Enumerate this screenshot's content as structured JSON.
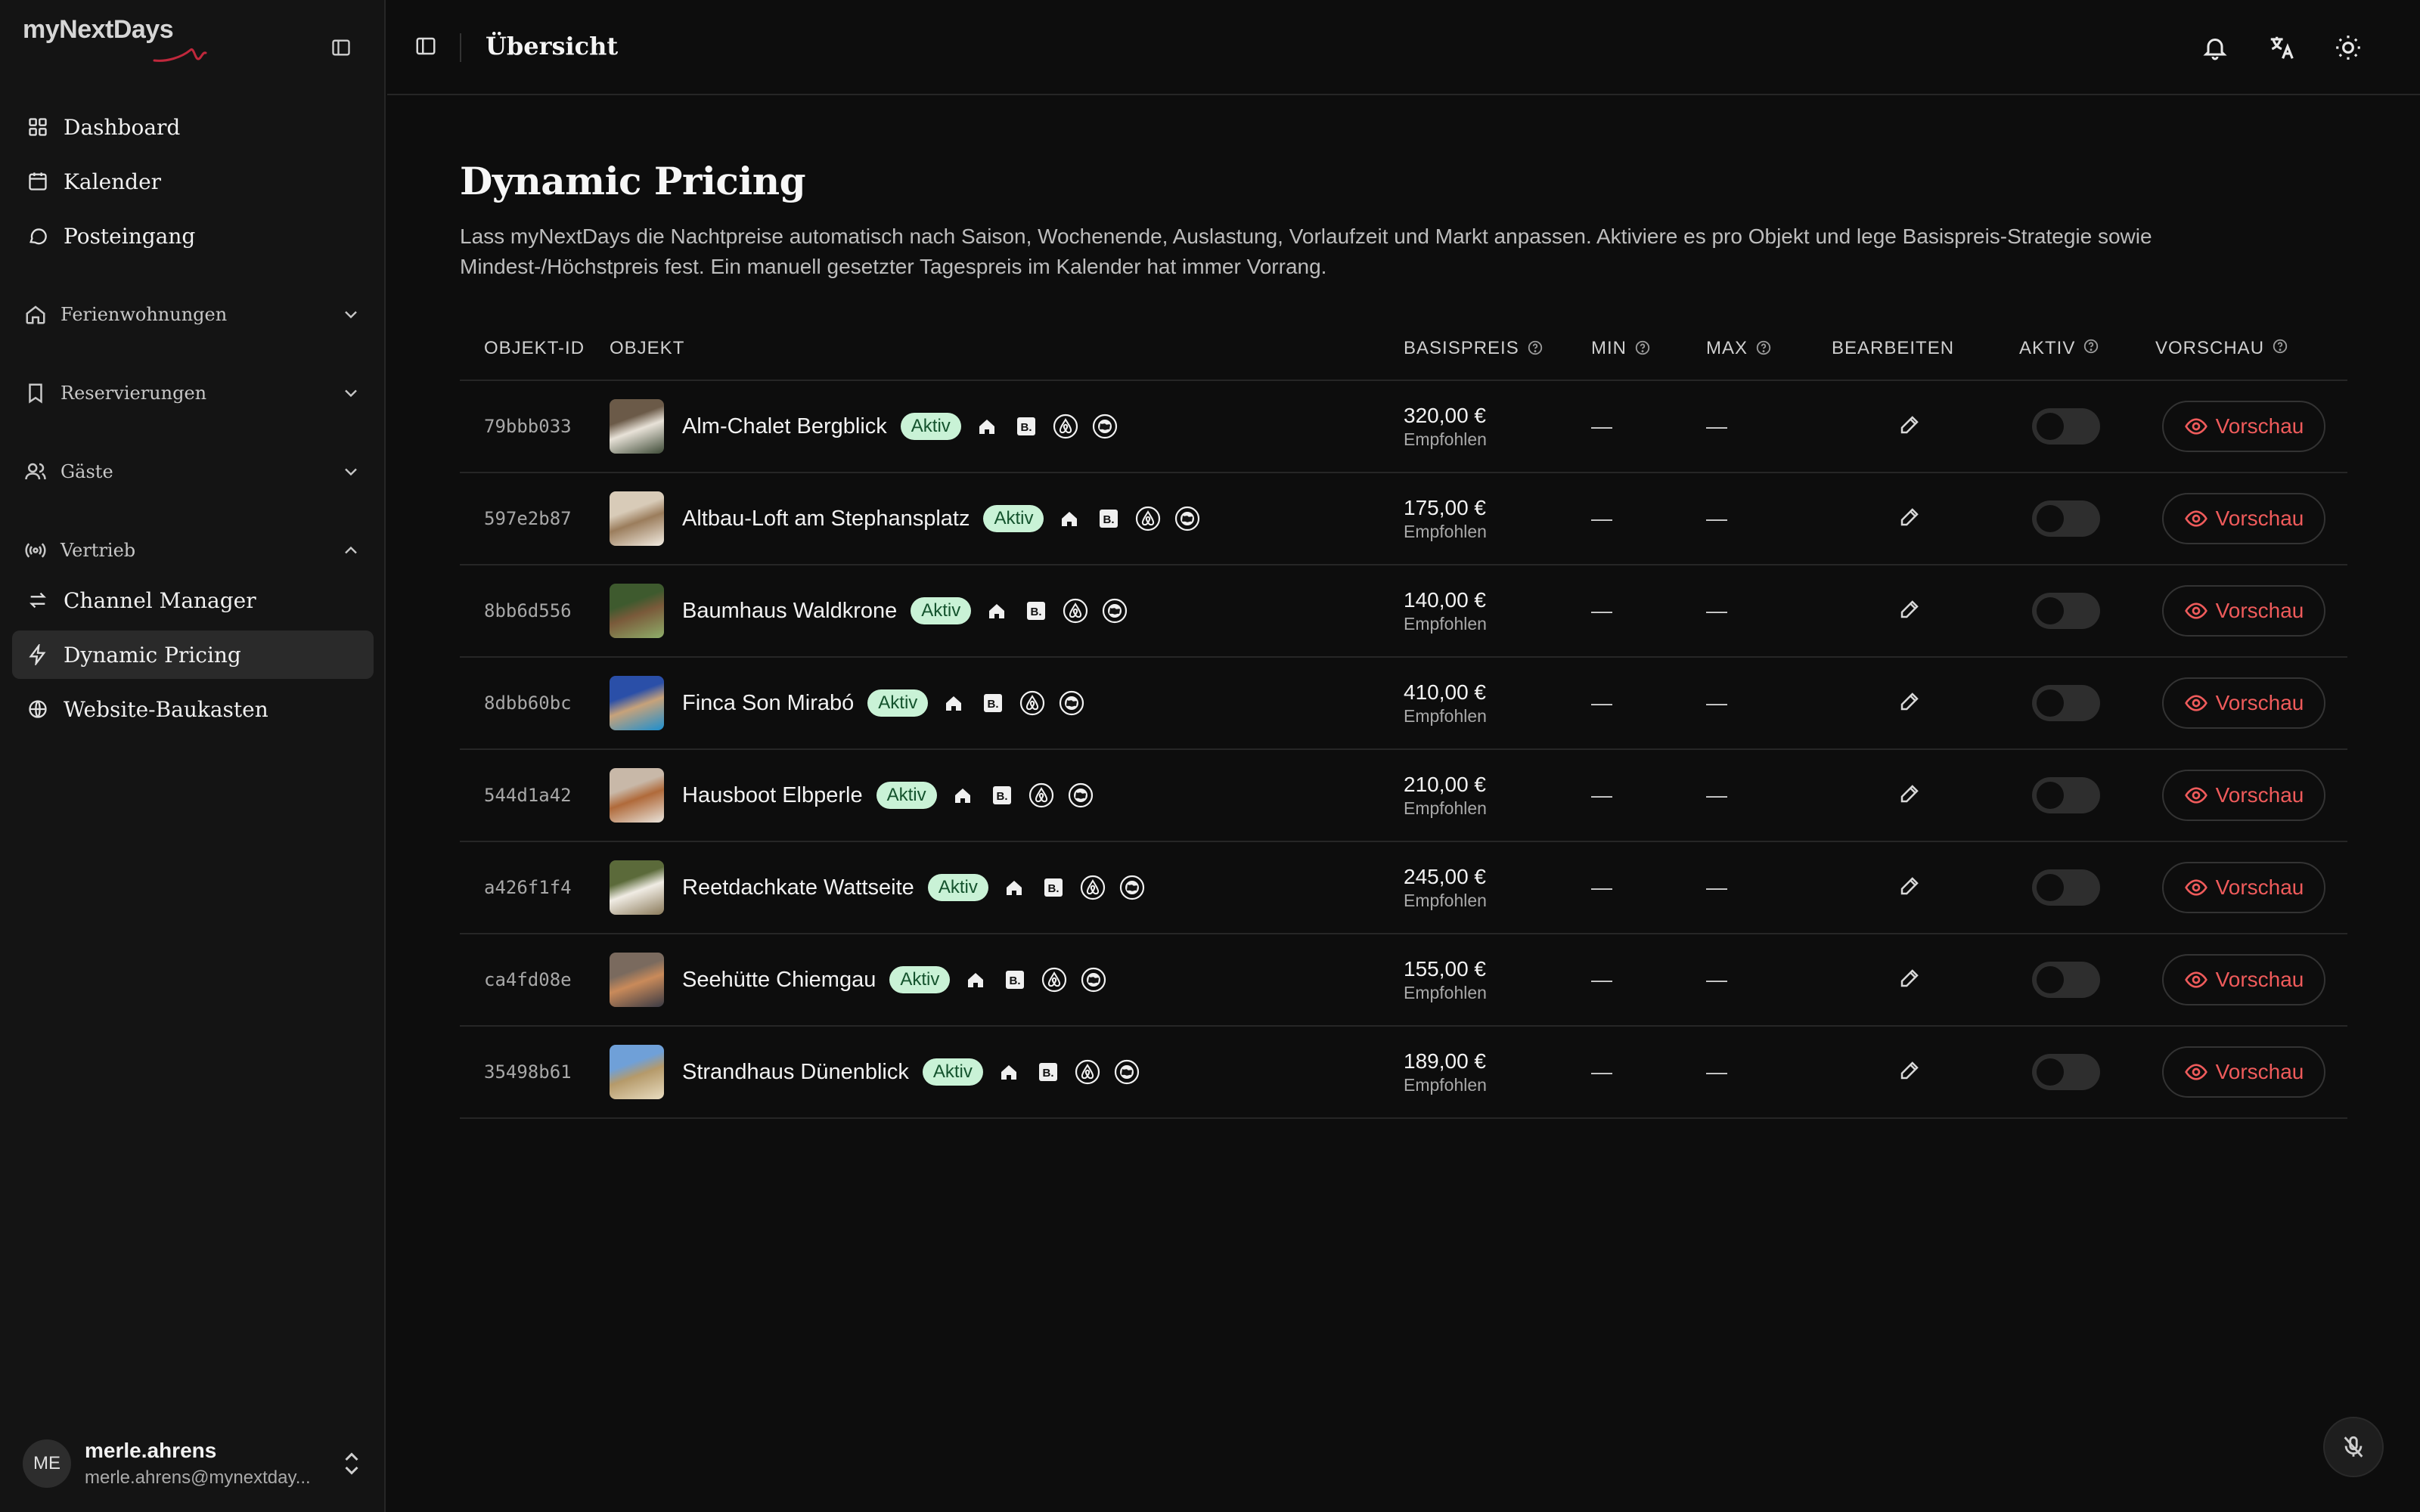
{
  "app": {
    "logo_text": "myNextDays",
    "header_title": "Übersicht",
    "colors": {
      "accent_red": "#ef5b5b",
      "badge_green_bg": "#c9f2d6",
      "badge_green_text": "#14532d",
      "bg": "#0d0d0d",
      "sidebar_bg": "#141414"
    }
  },
  "sidebar": {
    "items": [
      {
        "label": "Dashboard",
        "icon": "grid-icon"
      },
      {
        "label": "Kalender",
        "icon": "calendar-icon"
      },
      {
        "label": "Posteingang",
        "icon": "message-icon"
      }
    ],
    "groups": [
      {
        "label": "Ferienwohnungen",
        "icon": "home-icon",
        "expanded": false
      },
      {
        "label": "Reservierungen",
        "icon": "bookmark-icon",
        "expanded": false
      },
      {
        "label": "Gäste",
        "icon": "users-icon",
        "expanded": false
      },
      {
        "label": "Vertrieb",
        "icon": "broadcast-icon",
        "expanded": true
      }
    ],
    "vertrieb_items": [
      {
        "label": "Channel Manager",
        "icon": "arrows-icon",
        "active": false
      },
      {
        "label": "Dynamic Pricing",
        "icon": "zap-icon",
        "active": true
      },
      {
        "label": "Website-Baukasten",
        "icon": "globe-icon",
        "active": false
      }
    ],
    "user": {
      "initials": "ME",
      "name": "merle.ahrens",
      "email": "merle.ahrens@mynextday..."
    }
  },
  "page": {
    "title": "Dynamic Pricing",
    "description": "Lass myNextDays die Nachtpreise automatisch nach Saison, Wochenende, Auslastung, Vorlaufzeit und Markt anpassen. Aktiviere es pro Objekt und lege Basispreis-Strategie sowie Mindest-/Höchstpreis fest. Ein manuell gesetzter Tagespreis im Kalender hat immer Vorrang."
  },
  "table": {
    "columns": {
      "id": "OBJEKT-ID",
      "object": "OBJEKT",
      "base_price": "BASISPREIS",
      "min": "MIN",
      "max": "MAX",
      "edit": "BEARBEITEN",
      "active": "AKTIV",
      "preview": "VORSCHAU"
    },
    "rows": [
      {
        "id": "79bbb033",
        "name": "Alm-Chalet Bergblick",
        "status": "Aktiv",
        "price": "320,00 €",
        "price_note": "Empfohlen",
        "min": "—",
        "max": "—",
        "enabled": false,
        "preview_label": "Vorschau",
        "thumb_colors": [
          "#6b5a48",
          "#e8e2d8",
          "#3d4a36"
        ]
      },
      {
        "id": "597e2b87",
        "name": "Altbau-Loft am Stephansplatz",
        "status": "Aktiv",
        "price": "175,00 €",
        "price_note": "Empfohlen",
        "min": "—",
        "max": "—",
        "enabled": false,
        "preview_label": "Vorschau",
        "thumb_colors": [
          "#d8cbb8",
          "#9b7d5c",
          "#f2ece2"
        ]
      },
      {
        "id": "8bb6d556",
        "name": "Baumhaus Waldkrone",
        "status": "Aktiv",
        "price": "140,00 €",
        "price_note": "Empfohlen",
        "min": "—",
        "max": "—",
        "enabled": false,
        "preview_label": "Vorschau",
        "thumb_colors": [
          "#3e5a2e",
          "#7a5a3a",
          "#8fae6a"
        ]
      },
      {
        "id": "8dbb60bc",
        "name": "Finca Son Mirabó",
        "status": "Aktiv",
        "price": "410,00 €",
        "price_note": "Empfohlen",
        "min": "—",
        "max": "—",
        "enabled": false,
        "preview_label": "Vorschau",
        "thumb_colors": [
          "#2a4fa8",
          "#c7a27a",
          "#1c8fd0"
        ]
      },
      {
        "id": "544d1a42",
        "name": "Hausboot Elbperle",
        "status": "Aktiv",
        "price": "210,00 €",
        "price_note": "Empfohlen",
        "min": "—",
        "max": "—",
        "enabled": false,
        "preview_label": "Vorschau",
        "thumb_colors": [
          "#c8b8a8",
          "#b06a3a",
          "#e9e4dc"
        ]
      },
      {
        "id": "a426f1f4",
        "name": "Reetdachkate Wattseite",
        "status": "Aktiv",
        "price": "245,00 €",
        "price_note": "Empfohlen",
        "min": "—",
        "max": "—",
        "enabled": false,
        "preview_label": "Vorschau",
        "thumb_colors": [
          "#5b6a3a",
          "#f0ece4",
          "#8a7a5a"
        ]
      },
      {
        "id": "ca4fd08e",
        "name": "Seehütte Chiemgau",
        "status": "Aktiv",
        "price": "155,00 €",
        "price_note": "Empfohlen",
        "min": "—",
        "max": "—",
        "enabled": false,
        "preview_label": "Vorschau",
        "thumb_colors": [
          "#7a6a5e",
          "#c98a5a",
          "#3a3a44"
        ]
      },
      {
        "id": "35498b61",
        "name": "Strandhaus Dünenblick",
        "status": "Aktiv",
        "price": "189,00 €",
        "price_note": "Empfohlen",
        "min": "—",
        "max": "—",
        "enabled": false,
        "preview_label": "Vorschau",
        "thumb_colors": [
          "#6fa0d8",
          "#b59a6a",
          "#e8dcc0"
        ]
      }
    ]
  }
}
